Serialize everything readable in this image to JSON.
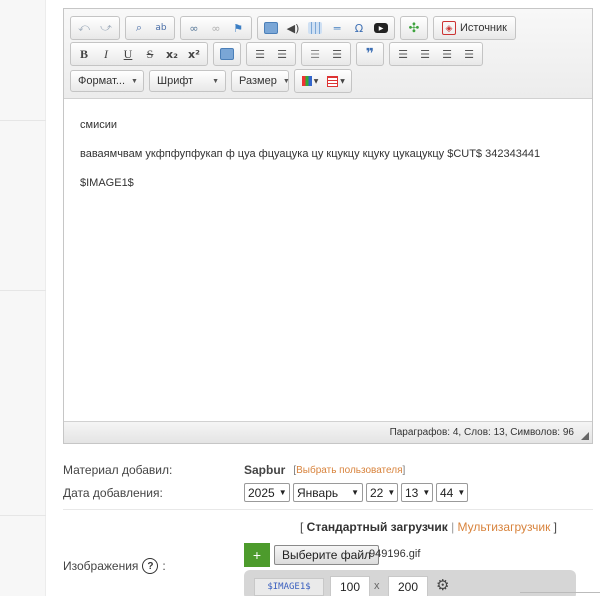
{
  "toolbar": {
    "row1": {
      "group1": [
        {
          "name": "undo-icon",
          "glyph": "⤺",
          "color": "#9aa8b8"
        },
        {
          "name": "redo-icon",
          "glyph": "⤻",
          "color": "#9aa8b8"
        }
      ],
      "group2": [
        {
          "name": "find-icon",
          "glyph": "🔍",
          "color": "#4b6fa8"
        },
        {
          "name": "replace-icon",
          "glyph": "ab",
          "color": "#4b6fa8"
        }
      ],
      "group3": [
        {
          "name": "link-icon",
          "glyph": "∞",
          "color": "#5a7a9a"
        },
        {
          "name": "unlink-icon",
          "glyph": "∞",
          "color": "#b0b0b0"
        },
        {
          "name": "anchor-icon",
          "glyph": "⚑",
          "color": "#3d7fc4"
        }
      ],
      "group4": [
        {
          "name": "image-icon",
          "glyph": "▣",
          "color": "#5b8fc7"
        },
        {
          "name": "audio-icon",
          "glyph": "🔊",
          "color": "#444444"
        },
        {
          "name": "table-icon",
          "glyph": "▦",
          "color": "#5b8fc7"
        },
        {
          "name": "horizontal-line-icon",
          "glyph": "═",
          "color": "#5b8fc7"
        },
        {
          "name": "special-char-icon",
          "glyph": "Ω",
          "color": "#3d6fb4"
        },
        {
          "name": "youtube-icon",
          "glyph": "▶",
          "color": "#222222"
        }
      ],
      "group5": [
        {
          "name": "maximize-icon",
          "glyph": "✣",
          "color": "#3ea33e"
        }
      ],
      "source_label": "Источник"
    },
    "row2": {
      "group1": [
        {
          "name": "bold-icon",
          "glyph": "B"
        },
        {
          "name": "italic-icon",
          "glyph": "I"
        },
        {
          "name": "underline-icon",
          "glyph": "U"
        },
        {
          "name": "strike-icon",
          "glyph": "S"
        },
        {
          "name": "subscript-icon",
          "glyph": "x₂"
        },
        {
          "name": "superscript-icon",
          "glyph": "x²"
        }
      ],
      "group2": [
        {
          "name": "remove-format-icon",
          "glyph": "⌫",
          "color": "#5b8fc7"
        }
      ],
      "group3": [
        {
          "name": "numbered-list-icon",
          "glyph": "≡",
          "color": "#555555"
        },
        {
          "name": "bulleted-list-icon",
          "glyph": "≡",
          "color": "#555555"
        }
      ],
      "group4": [
        {
          "name": "outdent-icon",
          "glyph": "⇤",
          "color": "#888888"
        },
        {
          "name": "indent-icon",
          "glyph": "⇥",
          "color": "#555555"
        }
      ],
      "group5": [
        {
          "name": "blockquote-icon",
          "glyph": "❞",
          "color": "#3d6fb4"
        }
      ],
      "group6": [
        {
          "name": "align-left-icon",
          "glyph": "≡",
          "color": "#555555"
        },
        {
          "name": "align-center-icon",
          "glyph": "≡",
          "color": "#555555"
        },
        {
          "name": "align-right-icon",
          "glyph": "≡",
          "color": "#555555"
        },
        {
          "name": "align-justify-icon",
          "glyph": "≡",
          "color": "#555555"
        }
      ]
    },
    "row3": {
      "format_label": "Формат...",
      "font_label": "Шрифт",
      "size_label": "Размер",
      "text_color_icon": "text-color-icon",
      "bg_color_icon": "background-color-icon"
    }
  },
  "editor": {
    "paragraphs": [
      "смиcии",
      "ваваямчвам укфпфупфукап ф цуа фцуацука цу кцукцу кцуку цукацукцу $CUT$ 342343441",
      "$IMAGE1$"
    ],
    "status": "Параграфов: 4, Слов: 13, Символов: 96"
  },
  "form": {
    "author_label": "Материал добавил:",
    "author_name": "Sapbur",
    "pick_user_link": "Выбрать пользователя",
    "date_label": "Дата добавления:",
    "year": "2025",
    "month": "Январь",
    "day": "22",
    "hour": "13",
    "minute": "44",
    "std_uploader": "Стандартный загрузчик",
    "multi_uploader": "Мультизагрузчик",
    "images_label": "Изображения",
    "choose_file_label": "Выберите файл",
    "file_name": "949196.gif",
    "image_tag": "$IMAGE1$",
    "width": "100",
    "height": "200",
    "x_sep": "x"
  }
}
